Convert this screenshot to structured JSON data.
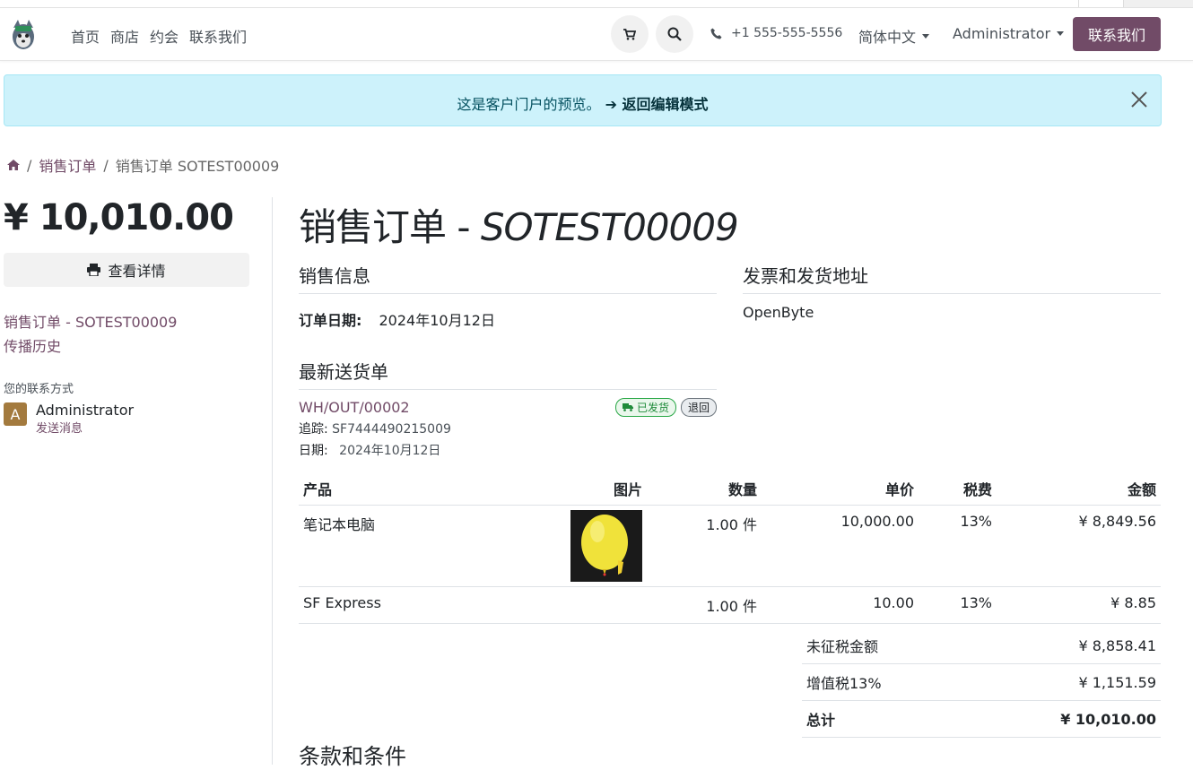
{
  "nav": {
    "links": [
      "首页",
      "商店",
      "约会",
      "联系我们"
    ],
    "phone": "+1 555-555-5556",
    "language": "简体中文",
    "user": "Administrator",
    "contact_button": "联系我们",
    "icons": [
      "cart-icon",
      "search-icon",
      "phone-icon"
    ]
  },
  "alert": {
    "text": "这是客户门户的预览。",
    "link": "➔ 返回编辑模式"
  },
  "breadcrumb": {
    "items": [
      "销售订单",
      "销售订单 SOTEST00009"
    ]
  },
  "sidebar": {
    "amount": "¥ 10,010.00",
    "detail_button": "查看详情",
    "order_link": "销售订单 - SOTEST00009",
    "history_link": "传播历史",
    "contact_label": "您的联系方式",
    "contact_initial": "A",
    "contact_name": "Administrator",
    "send_message": "发送消息"
  },
  "main": {
    "title_prefix": "销售订单 - ",
    "title_ref": "SOTEST00009",
    "sales_info_heading": "销售信息",
    "order_date_label": "订单日期:",
    "order_date": "2024年10月12日",
    "address_heading": "发票和发货地址",
    "address": "OpenByte",
    "delivery_heading": "最新送货单",
    "delivery_ref": "WH/OUT/00002",
    "shipped_badge": "已发货",
    "return_badge": "退回",
    "tracking_label": "追踪:",
    "tracking": "SF7444490215009",
    "date_label": "日期:",
    "delivery_date": "2024年10月12日",
    "terms_heading": "条款和条件"
  },
  "table": {
    "headers": [
      "产品",
      "图片",
      "数量",
      "单价",
      "税费",
      "金额"
    ],
    "rows": [
      {
        "product": "笔记本电脑",
        "qty": "1.00 件",
        "price": "10,000.00",
        "tax": "13%",
        "amount": "¥ 8,849.56"
      },
      {
        "product": "SF Express",
        "qty": "1.00 件",
        "price": "10.00",
        "tax": "13%",
        "amount": "¥ 8.85"
      }
    ]
  },
  "totals": {
    "untaxed_label": "未征税金额",
    "untaxed": "¥ 8,858.41",
    "vat_label": "增值税13%",
    "vat": "¥ 1,151.59",
    "total_label": "总计",
    "total": "¥ 10,010.00"
  },
  "colors": {
    "brand": "#714b67",
    "alert_bg": "#cdf2fb"
  }
}
